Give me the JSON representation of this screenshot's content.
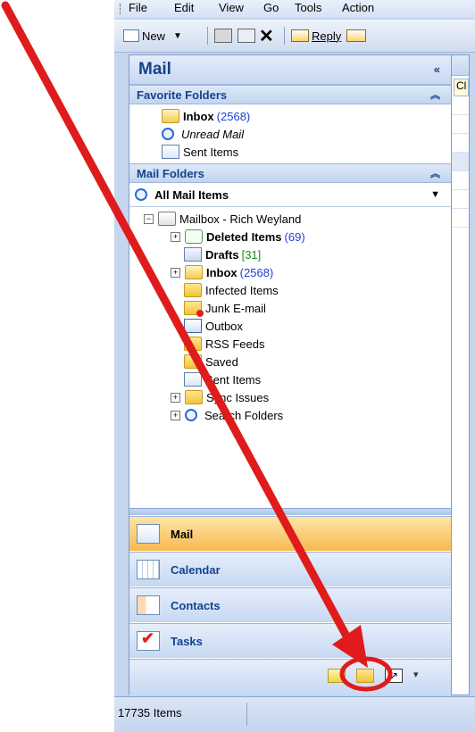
{
  "menubar": {
    "items": [
      "File",
      "Edit",
      "View",
      "Go",
      "Tools",
      "Action"
    ]
  },
  "toolbar": {
    "new_label": "New",
    "reply_label": "Reply"
  },
  "nav": {
    "title": "Mail",
    "favorites_header": "Favorite Folders",
    "favorites": [
      {
        "label": "Inbox",
        "count": "(2568)",
        "icon": "inbox-icon"
      },
      {
        "label": "Unread Mail",
        "icon": "search-folder-icon"
      },
      {
        "label": "Sent Items",
        "icon": "sent-items-icon"
      }
    ],
    "mail_folders_header": "Mail Folders",
    "all_mail_items": "All Mail Items",
    "mailbox": "Mailbox - Rich Weyland",
    "folders": [
      {
        "label": "Deleted Items",
        "count": "(69)",
        "bold": true
      },
      {
        "label": "Drafts",
        "count": "[31]",
        "bold": true
      },
      {
        "label": "Inbox",
        "count": "(2568)",
        "bold": true
      },
      {
        "label": "Infected Items"
      },
      {
        "label": "Junk E-mail"
      },
      {
        "label": "Outbox"
      },
      {
        "label": "RSS Feeds"
      },
      {
        "label": "Saved"
      },
      {
        "label": "Sent Items"
      },
      {
        "label": "Sync Issues"
      },
      {
        "label": "Search Folders"
      }
    ],
    "buttons": [
      "Mail",
      "Calendar",
      "Contacts",
      "Tasks"
    ]
  },
  "reading": {
    "cl_text": "Cl"
  },
  "status": {
    "items_count": "17735 Items"
  },
  "colors": {
    "accent": "#15428b",
    "arrow": "#e01b1b",
    "active_nav": "#f7b94f"
  }
}
